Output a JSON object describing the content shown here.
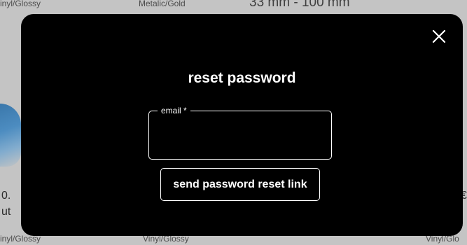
{
  "background": {
    "top_texts": [
      "inyl/Glossy",
      "Metalic/Gold",
      "33 mm - 100 mm"
    ],
    "bottom_texts": [
      "inyl/Glossy",
      "Vinyl/Glossy",
      "Vinyl/Glo"
    ],
    "left_texts": [
      "0.",
      "ut"
    ],
    "right_texts": [
      "€"
    ]
  },
  "modal": {
    "title": "reset password",
    "close_icon": "close-icon",
    "email_field": {
      "label": "email *",
      "value": "",
      "placeholder": ""
    },
    "submit_label": "send password reset link"
  },
  "colors": {
    "modal_background": "#000000",
    "text": "#ffffff",
    "backdrop": "#c4c4c4"
  }
}
